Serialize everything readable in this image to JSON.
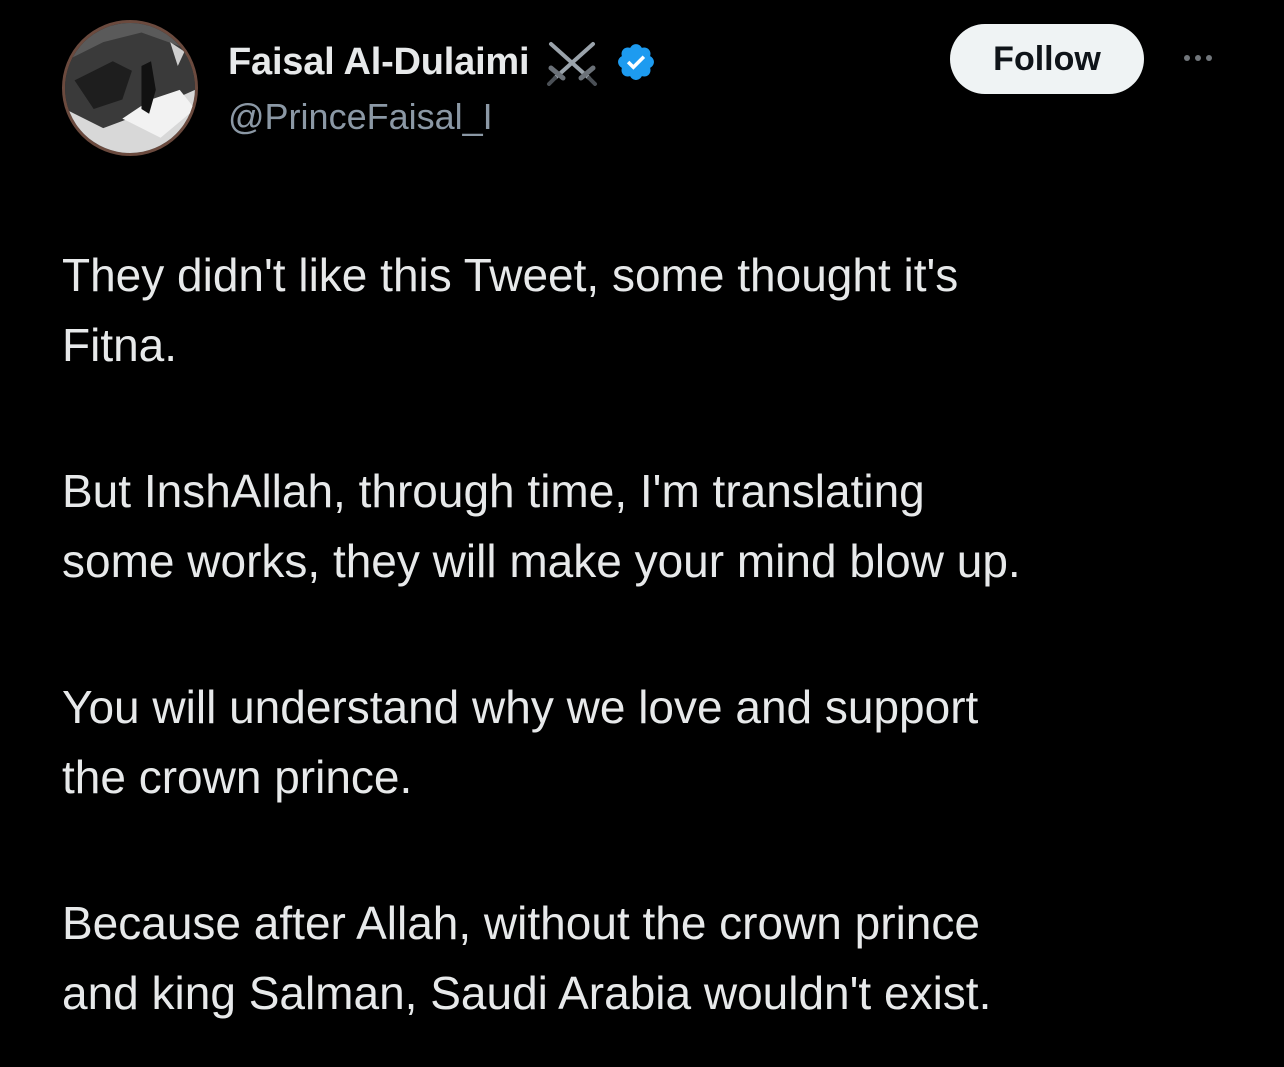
{
  "author": {
    "display_name": "Faisal Al-Dulaimi",
    "handle": "@PrinceFaisal_I",
    "name_emoji": "crossed-swords-icon",
    "verified": true,
    "verified_color": "#1d9bf0"
  },
  "actions": {
    "follow_label": "Follow",
    "more_icon": "more-options-icon"
  },
  "tweet": {
    "paragraphs": [
      {
        "line1": "They didn't like this Tweet, some thought it's",
        "line2": "Fitna."
      },
      {
        "line1": "But InshAllah, through time, I'm translating",
        "line2": "some works, they will make your mind blow up."
      },
      {
        "line1": "You will understand why we love and support",
        "line2": "the crown prince."
      },
      {
        "line1": "Because after Allah, without the crown prince",
        "line2": "and king Salman, Saudi Arabia wouldn't exist."
      }
    ]
  },
  "colors": {
    "background": "#000000",
    "text": "#e7e9ea",
    "secondary_text": "#8b98a5",
    "follow_button_bg": "#eff3f4"
  }
}
